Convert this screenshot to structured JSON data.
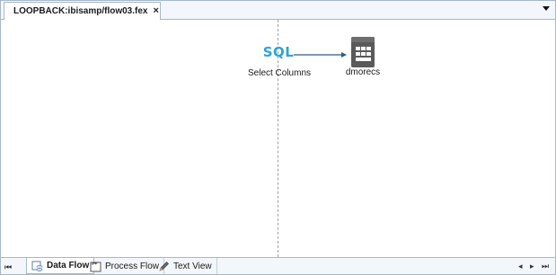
{
  "document_tab": {
    "title": "LOOPBACK:ibisamp/flow03.fex",
    "close_glyph": "×",
    "icon": "flow-document-icon"
  },
  "canvas": {
    "sql_node": {
      "text": "SQL",
      "label": "Select Columns",
      "color": "#2ea3d6"
    },
    "target_node": {
      "label": "dmorecs",
      "icon": "database-table-icon"
    }
  },
  "bottom_tabs": [
    {
      "label": "Data Flow",
      "icon": "data-flow-icon",
      "active": true
    },
    {
      "label": "Process Flow",
      "icon": "process-flow-icon",
      "active": false
    },
    {
      "label": "Text View",
      "icon": "pencil-icon",
      "active": false
    }
  ],
  "navigation": {
    "first": "⏮",
    "prev": "◂",
    "next": "▸",
    "last": "⏭"
  },
  "colors": {
    "border": "#a9b7c9",
    "chrome_background": "#f3f6fa",
    "sql_accent": "#2ea3d6",
    "node_icon": "#555555"
  }
}
